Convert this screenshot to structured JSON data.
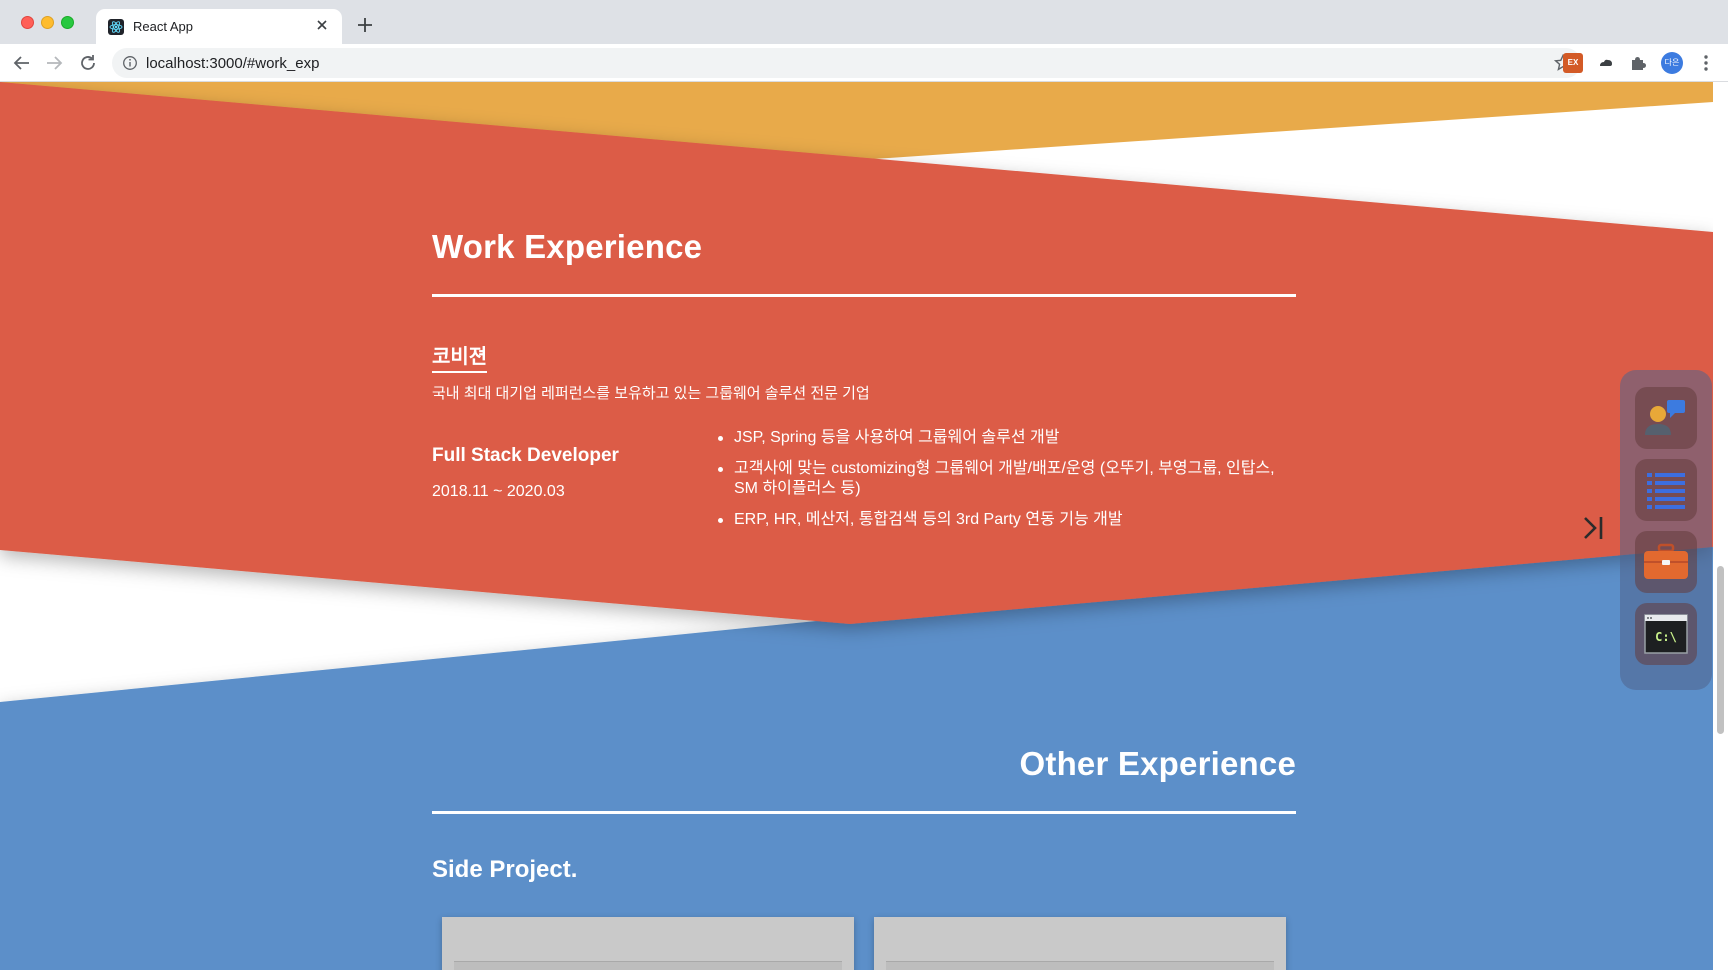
{
  "browser": {
    "tab_title": "React App",
    "url": "localhost:3000/#work_exp",
    "extension_label": "EX",
    "avatar_text": "다은"
  },
  "colors": {
    "orange_band": "#e8aa4a",
    "red_band": "#dc5c46",
    "blue_band": "#5b8fc9",
    "text": "#ffffff"
  },
  "work": {
    "title": "Work Experience",
    "company": "코비젼",
    "company_desc": "국내 최대 대기업 레퍼런스를 보유하고 있는 그룹웨어 솔루션 전문 기업",
    "role": "Full Stack Developer",
    "period": "2018.11 ~ 2020.03",
    "duties": [
      "JSP, Spring 등을 사용하여 그룹웨어 솔루션 개발",
      "고객사에 맞는 customizing형 그룹웨어 개발/배포/운영 (오뚜기, 부영그룹, 인탑스, SM 하이플러스 등)",
      "ERP, HR, 메산저, 통합검색 등의 3rd Party 연동 기능 개발"
    ]
  },
  "other": {
    "title": "Other Experience",
    "side_project": "Side Project."
  },
  "dock": {
    "items": [
      "profile-chat-icon",
      "list-icon",
      "briefcase-icon",
      "terminal-icon"
    ],
    "terminal_label": "C:\\",
    "collapse_icon": "collapse-right-icon"
  }
}
